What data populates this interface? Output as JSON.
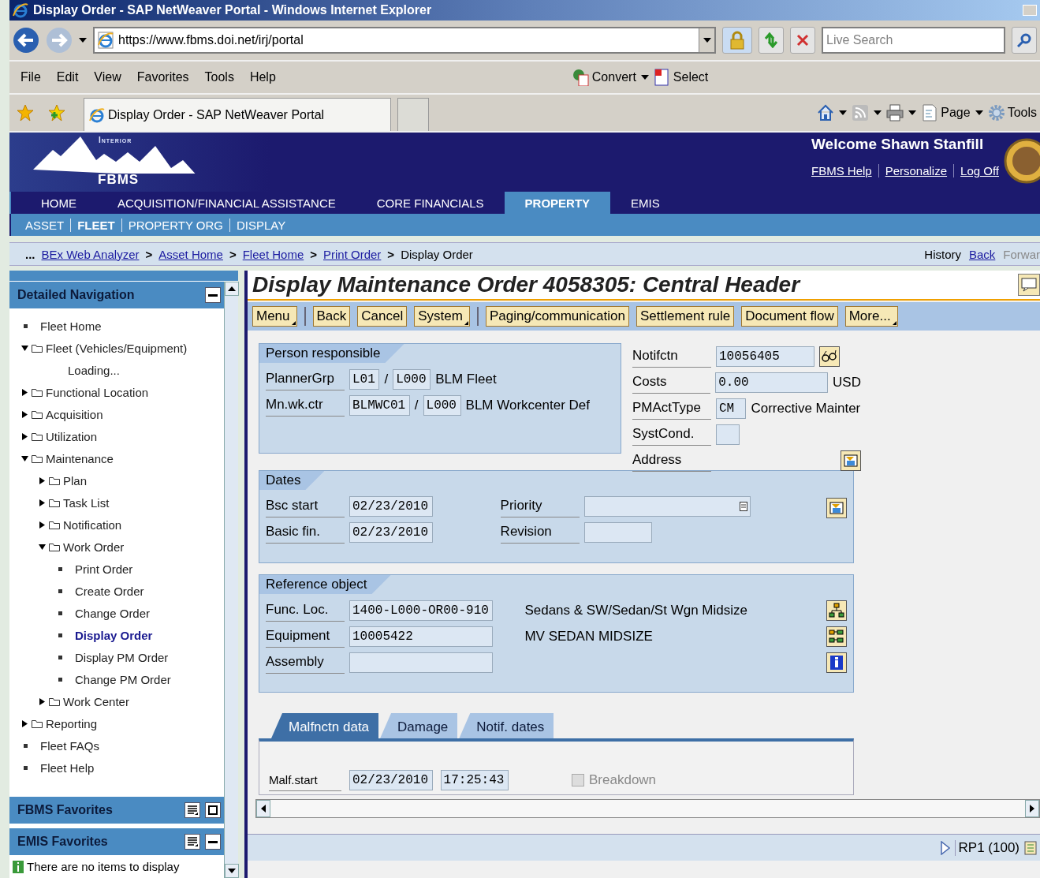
{
  "window": {
    "title": "Display Order - SAP NetWeaver Portal - Windows Internet Explorer"
  },
  "address_bar": {
    "url": "https://www.fbms.doi.net/irj/portal",
    "search_placeholder": "Live Search"
  },
  "menu_bar": {
    "items": [
      "File",
      "Edit",
      "View",
      "Favorites",
      "Tools",
      "Help"
    ],
    "addons": [
      {
        "kind": "convert",
        "label": "Convert"
      },
      {
        "kind": "select",
        "label": "Select"
      }
    ]
  },
  "favorites_bar": {
    "tab": "Display Order - SAP NetWeaver Portal",
    "tools": [
      {
        "kind": "home"
      },
      {
        "kind": "feed"
      },
      {
        "kind": "print"
      },
      {
        "kind": "page",
        "label": "Page"
      },
      {
        "kind": "tools",
        "label": "Tools"
      }
    ]
  },
  "portal_header": {
    "logo_top": "Interior",
    "logo_bottom": "FBMS",
    "welcome": "Welcome Shawn Stanfill",
    "links": [
      "FBMS Help",
      "Personalize",
      "Log Off"
    ]
  },
  "top_nav": [
    {
      "label": "HOME",
      "selected": false
    },
    {
      "label": "ACQUISITION/FINANCIAL ASSISTANCE",
      "selected": false
    },
    {
      "label": "CORE FINANCIALS",
      "selected": false
    },
    {
      "label": "PROPERTY",
      "selected": true
    },
    {
      "label": "EMIS",
      "selected": false
    }
  ],
  "sub_nav": [
    {
      "label": "ASSET",
      "selected": false
    },
    {
      "label": "FLEET",
      "selected": true
    },
    {
      "label": "PROPERTY ORG",
      "selected": false
    },
    {
      "label": "DISPLAY",
      "selected": false
    }
  ],
  "breadcrumb": {
    "ellipsis": "...",
    "links": [
      "BEx Web Analyzer",
      "Asset Home",
      "Fleet Home",
      "Print Order"
    ],
    "separator": ">",
    "current": "Display Order",
    "history": "History",
    "back": "Back",
    "forward": "Forwar"
  },
  "navigation": {
    "title": "Detailed Navigation",
    "items": [
      {
        "kind": "leaf",
        "label": "Fleet Home",
        "selected": false
      },
      {
        "kind": "folder",
        "label": "Fleet (Vehicles/Equipment)",
        "expanded": true,
        "children": [
          {
            "kind": "note",
            "label": "Loading..."
          }
        ]
      },
      {
        "kind": "folder",
        "label": "Functional Location",
        "expanded": false
      },
      {
        "kind": "folder",
        "label": "Acquisition",
        "expanded": false
      },
      {
        "kind": "folder",
        "label": "Utilization",
        "expanded": false
      },
      {
        "kind": "folder",
        "label": "Maintenance",
        "expanded": true,
        "children": [
          {
            "kind": "folder",
            "label": "Plan",
            "expanded": false
          },
          {
            "kind": "folder",
            "label": "Task List",
            "expanded": false
          },
          {
            "kind": "folder",
            "label": "Notification",
            "expanded": false
          },
          {
            "kind": "folder",
            "label": "Work Order",
            "expanded": true,
            "children": [
              {
                "kind": "leaf",
                "label": "Print Order",
                "selected": false
              },
              {
                "kind": "leaf",
                "label": "Create Order",
                "selected": false
              },
              {
                "kind": "leaf",
                "label": "Change Order",
                "selected": false
              },
              {
                "kind": "leaf",
                "label": "Display Order",
                "selected": true
              },
              {
                "kind": "leaf",
                "label": "Display PM Order",
                "selected": false
              },
              {
                "kind": "leaf",
                "label": "Change PM Order",
                "selected": false
              }
            ]
          },
          {
            "kind": "folder",
            "label": "Work Center",
            "expanded": false
          }
        ]
      },
      {
        "kind": "folder",
        "label": "Reporting",
        "expanded": false
      },
      {
        "kind": "leaf",
        "label": "Fleet FAQs",
        "selected": false
      },
      {
        "kind": "leaf",
        "label": "Fleet Help",
        "selected": false
      }
    ]
  },
  "favorites": [
    {
      "title": "FBMS Favorites",
      "expanded": false
    },
    {
      "title": "EMIS Favorites",
      "expanded": true,
      "message": "There are no items to display"
    }
  ],
  "page": {
    "title": "Display Maintenance Order 4058305: Central Header",
    "toolbar": [
      {
        "label": "Menu",
        "menu": true
      },
      {
        "kind": "separator"
      },
      {
        "label": "Back",
        "menu": false
      },
      {
        "label": "Cancel",
        "menu": false
      },
      {
        "label": "System",
        "menu": true
      },
      {
        "kind": "separator"
      },
      {
        "label": "Paging/communication",
        "menu": false
      },
      {
        "label": "Settlement rule",
        "menu": false
      },
      {
        "label": "Document flow",
        "menu": false
      },
      {
        "label": "More...",
        "menu": true
      }
    ],
    "person_responsible": {
      "title": "Person responsible",
      "rows": [
        {
          "label": "PlannerGrp",
          "values": [
            "L01",
            "L000"
          ],
          "separator": "/",
          "text": "BLM Fleet"
        },
        {
          "label": "Mn.wk.ctr",
          "values": [
            "BLMWC01",
            "L000"
          ],
          "separator": "/",
          "text": "BLM Workcenter Def"
        }
      ]
    },
    "notification": [
      {
        "kind": "field",
        "label": "Notifctn",
        "value": "10056405",
        "button": {
          "kind": "glasses"
        }
      },
      {
        "kind": "field",
        "label": "Costs",
        "value": "0.00",
        "unit": "USD"
      },
      {
        "kind": "field",
        "label": "PMActType",
        "value": "CM",
        "text": "Corrective Mainter"
      },
      {
        "kind": "field",
        "label": "SystCond."
      },
      {
        "kind": "button",
        "label": "Address",
        "button": {
          "kind": "address"
        }
      }
    ],
    "dates": {
      "title": "Dates",
      "left": [
        {
          "label": "Bsc start",
          "value": "02/23/2010"
        },
        {
          "label": "Basic fin.",
          "value": "02/23/2010"
        }
      ],
      "right": [
        {
          "label": "Priority",
          "kind": "dropdown"
        },
        {
          "label": "Revision",
          "kind": "field"
        }
      ],
      "button": {
        "kind": "address"
      }
    },
    "reference_object": {
      "title": "Reference object",
      "rows": [
        {
          "label": "Func. Loc.",
          "value": "1400-L000-OR00-910",
          "text": "Sedans & SW/Sedan/St Wgn Midsize",
          "button": {
            "kind": "hierarchy"
          }
        },
        {
          "label": "Equipment",
          "value": "10005422",
          "text": "MV SEDAN MIDSIZE",
          "button": {
            "kind": "structure"
          }
        },
        {
          "label": "Assembly",
          "button": {
            "kind": "info"
          }
        }
      ]
    },
    "tabs": [
      {
        "label": "Malfnctn data",
        "selected": true
      },
      {
        "label": "Damage",
        "selected": false
      },
      {
        "label": "Notif. dates",
        "selected": false
      }
    ],
    "malfunction": {
      "label": "Malf.start",
      "date": "02/23/2010",
      "time": "17:25:43",
      "breakdown": {
        "label": "Breakdown",
        "checked": false,
        "disabled": true
      }
    }
  },
  "status_bar": {
    "system": "RP1 (100)"
  }
}
